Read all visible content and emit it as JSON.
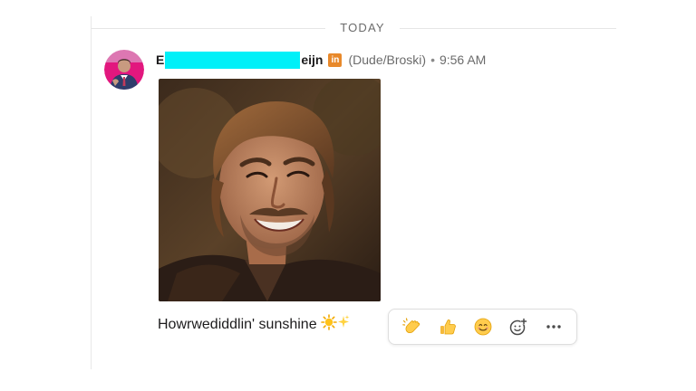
{
  "divider": {
    "label": "TODAY"
  },
  "message": {
    "author_prefix": "E",
    "author_suffix": "eijn",
    "badge_letters": "in",
    "pronouns": "(Dude/Broski)",
    "separator": "•",
    "timestamp": "9:56 AM",
    "text": "Howrwediddlin' sunshine"
  },
  "icons": {
    "avatar": "avatar-photo",
    "linkedin_badge": "linkedin-icon",
    "message_emoji": [
      "sun-icon",
      "sparkles-icon"
    ],
    "reactions": [
      "clap-icon",
      "thumbs-up-icon",
      "smile-icon",
      "add-reaction-icon",
      "more-icon"
    ]
  },
  "colors": {
    "redaction": "#00f0f8",
    "linkedin_badge": "#e8892b",
    "avatar_ring": "#e2177e"
  }
}
